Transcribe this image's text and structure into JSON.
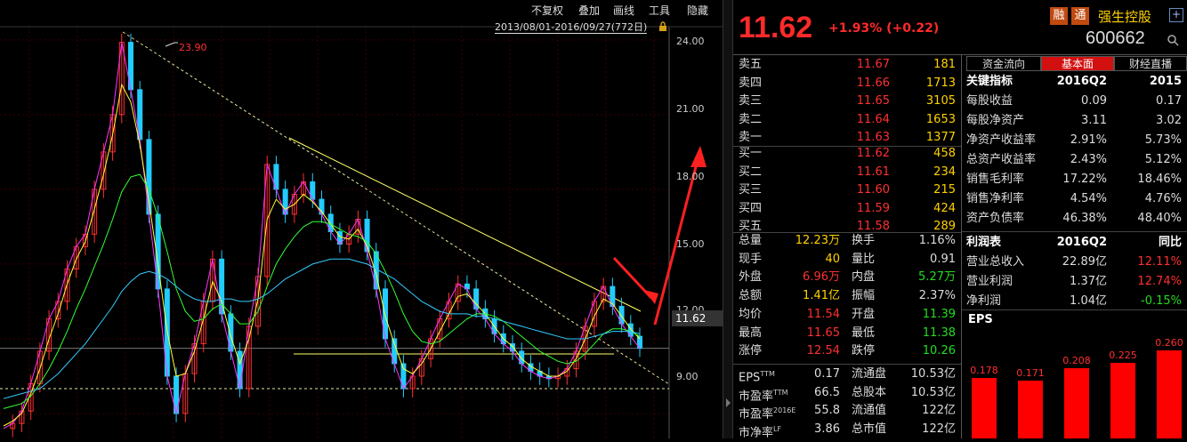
{
  "menu": {
    "items": [
      "不复权",
      "叠加",
      "画线",
      "工具",
      "隐藏"
    ]
  },
  "chart_header": {
    "date_range": "2013/08/01-2016/09/27(772日)"
  },
  "chart": {
    "y_ticks": [
      "24.00",
      "21.00",
      "18.00",
      "15.00",
      "12.00",
      "9.00"
    ],
    "high_label": "23.90",
    "current_price_label": "11.62"
  },
  "chart_data": {
    "type": "line",
    "title": "",
    "ylim": [
      8.0,
      25.6
    ],
    "y_ticks": [
      9.0,
      12.0,
      15.0,
      18.0,
      21.0,
      24.0
    ],
    "annotations": [
      {
        "text": "23.90",
        "kind": "max-price"
      },
      {
        "text": "11.62",
        "kind": "last-price"
      }
    ],
    "series": [
      {
        "values": [
          8.4,
          8.6,
          9.1,
          10.2,
          11.5,
          12.8,
          13.5,
          14.8,
          15.7,
          16.2,
          18.0,
          19.5,
          21.0,
          23.9,
          22.0,
          20.0,
          17.0,
          14.0,
          10.5,
          9.0,
          10.6,
          11.8,
          13.5,
          15.2,
          13.0,
          11.5,
          10.0,
          12.5,
          14.5,
          19.0,
          18.0,
          17.0,
          17.8,
          18.3,
          17.6,
          17.0,
          16.3,
          15.8,
          16.2,
          16.8,
          15.5,
          14.0,
          12.0,
          11.0,
          10.0,
          10.5,
          11.2,
          12.0,
          12.8,
          13.5,
          14.2,
          14.0,
          13.2,
          12.8,
          12.2,
          11.8,
          11.5,
          11.0,
          10.7,
          10.5,
          10.4,
          10.5,
          10.8,
          11.5,
          12.5,
          13.5,
          14.1,
          13.3,
          12.6,
          12.1,
          11.62
        ]
      },
      {
        "values": [
          8.5,
          8.7,
          9.0,
          9.8,
          10.8,
          12.0,
          13.0,
          14.2,
          15.2,
          15.9,
          17.2,
          18.6,
          20.2,
          22.2,
          21.5,
          19.8,
          17.5,
          15.0,
          12.3,
          10.5,
          10.6,
          11.5,
          12.8,
          14.3,
          13.5,
          12.1,
          11.0,
          12.0,
          13.6,
          16.8,
          17.6,
          17.2,
          17.4,
          17.8,
          17.5,
          17.1,
          16.6,
          16.1,
          16.0,
          16.4,
          15.7,
          14.6,
          12.9,
          11.8,
          10.8,
          10.6,
          11.0,
          11.6,
          12.3,
          13.0,
          13.7,
          13.8,
          13.4,
          13.0,
          12.5,
          12.0,
          11.7,
          11.2,
          10.9,
          10.7,
          10.5,
          10.5,
          10.7,
          11.2,
          12.0,
          12.9,
          13.6,
          13.4,
          12.9,
          12.4,
          12.0
        ]
      },
      {
        "values": [
          9.2,
          9.3,
          9.4,
          9.7,
          10.2,
          10.8,
          11.5,
          12.3,
          13.2,
          14.0,
          14.9,
          15.8,
          16.8,
          17.9,
          18.5,
          18.6,
          18.0,
          16.9,
          15.5,
          14.0,
          13.1,
          12.7,
          12.8,
          13.2,
          13.4,
          13.0,
          12.6,
          12.6,
          13.1,
          14.1,
          15.0,
          15.6,
          16.1,
          16.5,
          16.7,
          16.7,
          16.6,
          16.4,
          16.2,
          16.1,
          15.9,
          15.4,
          14.7,
          13.9,
          13.0,
          12.3,
          11.9,
          11.8,
          11.9,
          12.2,
          12.5,
          12.8,
          13.0,
          13.0,
          12.9,
          12.7,
          12.4,
          12.1,
          11.8,
          11.5,
          11.3,
          11.1,
          11.0,
          11.1,
          11.4,
          11.8,
          12.2,
          12.4,
          12.4,
          12.3,
          12.1
        ]
      },
      {
        "values": [
          9.6,
          9.7,
          9.8,
          9.9,
          10.0,
          10.3,
          10.6,
          11.0,
          11.4,
          11.8,
          12.3,
          12.8,
          13.3,
          13.9,
          14.3,
          14.6,
          14.7,
          14.6,
          14.4,
          14.1,
          13.8,
          13.6,
          13.5,
          13.5,
          13.6,
          13.6,
          13.5,
          13.5,
          13.6,
          13.8,
          14.1,
          14.4,
          14.6,
          14.8,
          15.0,
          15.1,
          15.2,
          15.2,
          15.2,
          15.1,
          15.0,
          14.8,
          14.6,
          14.4,
          14.1,
          13.8,
          13.5,
          13.3,
          13.1,
          13.0,
          13.0,
          13.0,
          12.9,
          12.9,
          12.8,
          12.7,
          12.6,
          12.5,
          12.4,
          12.3,
          12.2,
          12.1,
          12.0,
          12.0,
          12.0,
          12.1,
          12.2,
          12.3,
          12.3,
          12.3,
          12.2
        ]
      }
    ]
  },
  "quote": {
    "price": "11.62",
    "change": "+1.93% (+0.22)",
    "tags": [
      "融",
      "通"
    ],
    "name": "强生控股",
    "plus": "+",
    "code": "600662",
    "asks": [
      {
        "label": "卖五",
        "price": "11.67",
        "vol": "181"
      },
      {
        "label": "卖四",
        "price": "11.66",
        "vol": "1713"
      },
      {
        "label": "卖三",
        "price": "11.65",
        "vol": "3105"
      },
      {
        "label": "卖二",
        "price": "11.64",
        "vol": "1653"
      },
      {
        "label": "卖一",
        "price": "11.63",
        "vol": "1377"
      }
    ],
    "bids": [
      {
        "label": "买一",
        "price": "11.62",
        "vol": "458"
      },
      {
        "label": "买二",
        "price": "11.61",
        "vol": "234"
      },
      {
        "label": "买三",
        "price": "11.60",
        "vol": "215"
      },
      {
        "label": "买四",
        "price": "11.59",
        "vol": "424"
      },
      {
        "label": "买五",
        "price": "11.58",
        "vol": "289"
      }
    ],
    "stats": [
      {
        "l1": "总量",
        "v1": "12.23万",
        "c1": "y",
        "l2": "换手",
        "v2": "1.16%",
        "c2": "w"
      },
      {
        "l1": "现手",
        "v1": "40",
        "c1": "y",
        "l2": "量比",
        "v2": "0.91",
        "c2": "w"
      },
      {
        "l1": "外盘",
        "v1": "6.96万",
        "c1": "r",
        "l2": "内盘",
        "v2": "5.27万",
        "c2": "g"
      },
      {
        "l1": "总额",
        "v1": "1.41亿",
        "c1": "y",
        "l2": "振幅",
        "v2": "2.37%",
        "c2": "w"
      },
      {
        "l1": "均价",
        "v1": "11.54",
        "c1": "r",
        "l2": "开盘",
        "v2": "11.39",
        "c2": "g"
      },
      {
        "l1": "最高",
        "v1": "11.65",
        "c1": "r",
        "l2": "最低",
        "v2": "11.38",
        "c2": "g"
      },
      {
        "l1": "涨停",
        "v1": "12.54",
        "c1": "r",
        "l2": "跌停",
        "v2": "10.26",
        "c2": "g"
      }
    ],
    "stats2": [
      {
        "l1": "EPS",
        "sup1": "TTM",
        "v1": "0.17",
        "l2": "流通盘",
        "v2": "10.53亿"
      },
      {
        "l1": "市盈率",
        "sup1": "TTM",
        "v1": "66.5",
        "l2": "总股本",
        "v2": "10.53亿"
      },
      {
        "l1": "市盈率",
        "sup1": "2016E",
        "v1": "55.8",
        "l2": "流通值",
        "v2": "122亿"
      },
      {
        "l1": "市净率",
        "sup1": "LF",
        "v1": "3.86",
        "l2": "总市值",
        "v2": "122亿"
      }
    ]
  },
  "tabs": [
    "资金流向",
    "基本面",
    "财经直播"
  ],
  "fundamentals": {
    "header": [
      "关键指标",
      "2016Q2",
      "2015"
    ],
    "rows": [
      [
        "每股收益",
        "0.09",
        "0.17"
      ],
      [
        "每股净资产",
        "3.11",
        "3.02"
      ],
      [
        "净资产收益率",
        "2.91%",
        "5.73%"
      ],
      [
        "总资产收益率",
        "2.43%",
        "5.12%"
      ],
      [
        "销售毛利率",
        "17.22%",
        "18.46%"
      ],
      [
        "销售净利率",
        "4.54%",
        "4.76%"
      ],
      [
        "资产负债率",
        "46.38%",
        "48.40%"
      ]
    ],
    "profit_header": [
      "利润表",
      "2016Q2",
      "同比"
    ],
    "profit_rows": [
      {
        "c0": "营业总收入",
        "c1": "22.89亿",
        "c2": "12.11%",
        "cc": "r"
      },
      {
        "c0": "营业利润",
        "c1": "1.37亿",
        "c2": "12.74%",
        "cc": "r"
      },
      {
        "c0": "净利润",
        "c1": "1.04亿",
        "c2": "-0.15%",
        "cc": "g"
      }
    ],
    "eps_title": "EPS",
    "eps_values": [
      0.178,
      0.171,
      0.208,
      0.225,
      0.26
    ],
    "eps_labels": [
      "0.178",
      "0.171",
      "0.208",
      "0.225",
      "0.260"
    ]
  }
}
